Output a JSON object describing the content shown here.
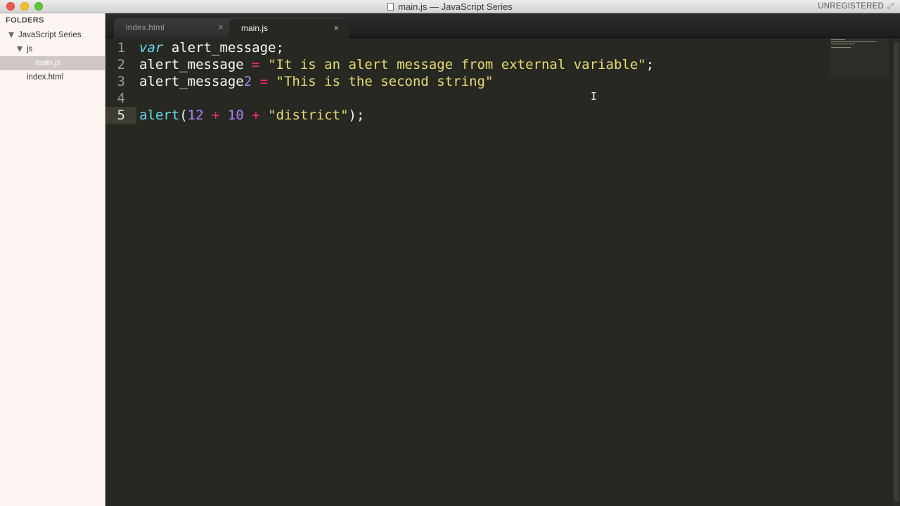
{
  "window": {
    "title": "main.js — JavaScript Series",
    "license": "UNREGISTERED"
  },
  "sidebar": {
    "header": "FOLDERS",
    "tree": [
      {
        "label": "JavaScript Series",
        "kind": "folder",
        "depth": 0,
        "expanded": true
      },
      {
        "label": "js",
        "kind": "folder",
        "depth": 1,
        "expanded": true
      },
      {
        "label": "main.js",
        "kind": "file",
        "depth": 2,
        "selected": true
      },
      {
        "label": "index.html",
        "kind": "file",
        "depth": 1
      }
    ]
  },
  "tabs": [
    {
      "label": "index.html",
      "active": false,
      "close": "×"
    },
    {
      "label": "main.js",
      "active": true,
      "close": "×"
    }
  ],
  "editor": {
    "current_line": 5,
    "lines": [
      {
        "number": "1",
        "code": "var alert_message;"
      },
      {
        "number": "2",
        "code": "alert_message = \"It is an alert message from external variable\";"
      },
      {
        "number": "3",
        "code": "alert_message2 = \"This is the second string\""
      },
      {
        "number": "4",
        "code": ""
      },
      {
        "number": "5",
        "code": "alert(12 + 10 + \"district\");"
      }
    ]
  },
  "colors": {
    "background": "#272822",
    "keyword": "#66d9ef",
    "operator": "#f92672",
    "string": "#e6db74",
    "number": "#ae81ff",
    "text": "#f8f8f2"
  }
}
